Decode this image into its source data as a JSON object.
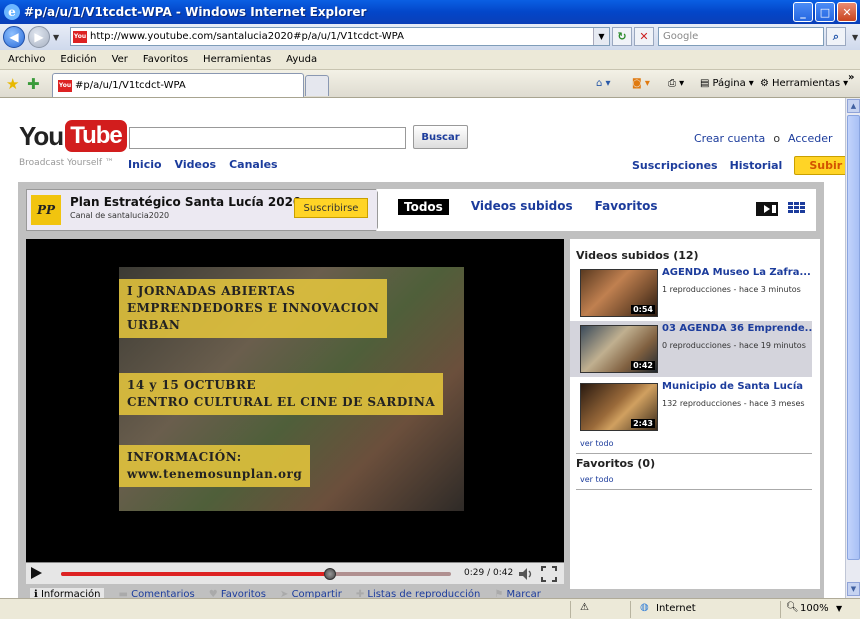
{
  "window": {
    "title": "#p/a/u/1/V1tcdct-WPA - Windows Internet Explorer"
  },
  "address": {
    "url": "http://www.youtube.com/santalucia2020#p/a/u/1/V1tcdct-WPA",
    "search_placeholder": "Google"
  },
  "menu": [
    "Archivo",
    "Edición",
    "Ver",
    "Favoritos",
    "Herramientas",
    "Ayuda"
  ],
  "tab": {
    "title": "#p/a/u/1/V1tcdct-WPA"
  },
  "commandbar": {
    "page_label": "Página",
    "tools_label": "Herramientas"
  },
  "status": {
    "zone": "Internet",
    "zoom": "100%"
  },
  "youtube": {
    "logo_you": "You",
    "logo_tube": "Tube",
    "tagline": "Broadcast Yourself ™",
    "search_button": "Buscar",
    "nav": [
      "Inicio",
      "Videos",
      "Canales"
    ],
    "create_account": "Crear cuenta",
    "or": "o",
    "signin": "Acceder",
    "subscriptions": "Suscripciones",
    "history": "Historial",
    "upload": "Subir"
  },
  "channel": {
    "logo_text": "PP",
    "title": "Plan Estratégico Santa Lucía 2020",
    "subtitle": "Canal de santalucia2020",
    "subscribe": "Suscribirse",
    "tabs": [
      "Todos",
      "Videos subidos",
      "Favoritos"
    ]
  },
  "player": {
    "overlay1": "I JORNADAS ABIERTAS\nEMPRENDEDORES E INNOVACION\nURBAN",
    "overlay2": "14 y 15 OCTUBRE\nCENTRO CULTURAL EL CINE DE SARDINA",
    "overlay3": "INFORMACIÓN:\nwww.tenemosunplan.org",
    "time": "0:29 / 0:42",
    "progress": 0.69
  },
  "info_tabs": [
    "Información",
    "Comentarios",
    "Favoritos",
    "Compartir",
    "Listas de reproducción",
    "Marcar"
  ],
  "sidebar": {
    "uploads_heading": "Videos subidos (12)",
    "videos": [
      {
        "title": "AGENDA Museo La Zafra...",
        "meta": "1 reproducciones - hace 3 minutos",
        "duration": "0:54"
      },
      {
        "title": "03 AGENDA 36 Emprende...",
        "meta": "0 reproducciones - hace 19 minutos",
        "duration": "0:42"
      },
      {
        "title": "Municipio de Santa Lucía",
        "meta": "132 reproducciones - hace 3 meses",
        "duration": "2:43"
      }
    ],
    "see_all": "ver todo",
    "favorites_heading": "Favoritos (0)",
    "see_all_fav": "ver todo"
  }
}
